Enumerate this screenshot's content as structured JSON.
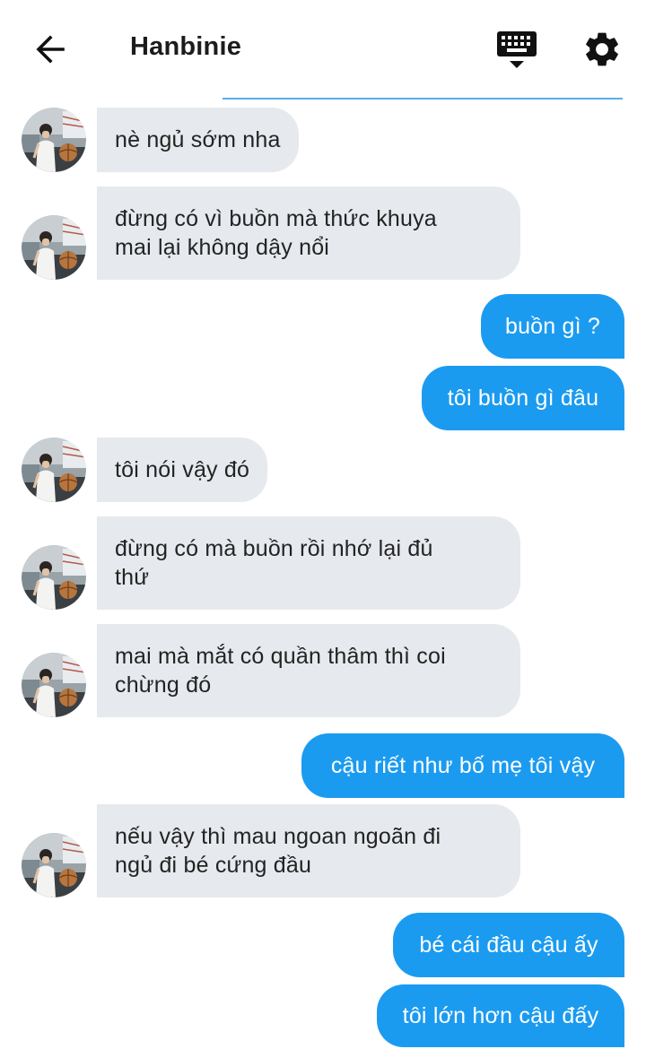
{
  "header": {
    "contact_name": "Hanbinie",
    "back_icon": "arrow-left-icon",
    "keyboard_icon": "keyboard-icon",
    "settings_icon": "gear-icon"
  },
  "colors": {
    "outgoing_bubble": "#1b9bf0",
    "incoming_bubble": "#e6e9ed",
    "divider": "#5aaee6"
  },
  "messages": [
    {
      "from": "contact",
      "text": "nè ngủ sớm nha"
    },
    {
      "from": "contact",
      "text": "đừng có vì buồn mà thức khuya\nmai lại không dậy nổi"
    },
    {
      "from": "me",
      "text": "buồn gì ?"
    },
    {
      "from": "me",
      "text": "tôi buồn gì đâu"
    },
    {
      "from": "contact",
      "text": "tôi nói vậy đó"
    },
    {
      "from": "contact",
      "text": "đừng có mà buồn rồi nhớ lại đủ\nthứ"
    },
    {
      "from": "contact",
      "text": "mai mà mắt có quần thâm thì coi\nchừng đó"
    },
    {
      "from": "me",
      "text": "cậu riết như bố mẹ tôi vậy"
    },
    {
      "from": "contact",
      "text": "nếu vậy thì mau ngoan ngoãn đi\nngủ đi bé cứng đầu"
    },
    {
      "from": "me",
      "text": "bé cái đầu cậu ấy"
    },
    {
      "from": "me",
      "text": "tôi lớn hơn cậu đấy"
    }
  ]
}
